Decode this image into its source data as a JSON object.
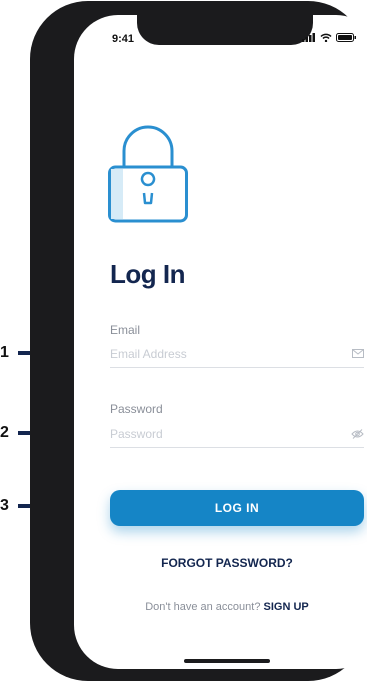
{
  "status_bar": {
    "time": "9:41"
  },
  "login": {
    "title": "Log In",
    "email_label": "Email",
    "email_placeholder": "Email Address",
    "password_label": "Password",
    "password_placeholder": "Password",
    "login_button": "LOG IN",
    "forgot_password": "FORGOT PASSWORD?",
    "no_account_text": "Don't have an account?",
    "sign_up": "SIGN UP"
  },
  "callouts": [
    "1",
    "2",
    "3"
  ],
  "colors": {
    "primary": "#1585c6",
    "navy": "#13264f",
    "lock": "#2a8fd0"
  },
  "icons": [
    "lock-icon",
    "mail-icon",
    "eye-off-icon",
    "signal-icon",
    "wifi-icon",
    "battery-icon"
  ]
}
